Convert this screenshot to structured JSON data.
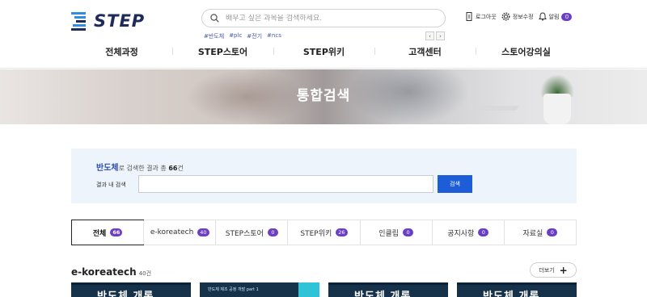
{
  "header": {
    "logo_text": "STEP",
    "search_placeholder": "배우고 싶은 과목을 검색하세요.",
    "tags": [
      "#반도체",
      "#plc",
      "#전기",
      "#ncs"
    ],
    "arrows": {
      "prev": "‹",
      "next": "›"
    },
    "util": {
      "logout": "로그아웃",
      "profile_edit": "정보수정",
      "alarm": "알림",
      "alarm_count": "0"
    }
  },
  "nav": [
    "전체과정",
    "STEP스토어",
    "STEP위키",
    "고객센터",
    "스토어강의실"
  ],
  "banner": {
    "title": "통합검색"
  },
  "result": {
    "keyword": "반도체",
    "summary_mid": "로 검색한 결과 총 ",
    "count": "66",
    "unit": "건",
    "inner_label": "결과 내 검색",
    "inner_value": "",
    "button": "검색"
  },
  "tabs": [
    {
      "label": "전체",
      "count": "66"
    },
    {
      "label": "e-koreatech",
      "count": "40"
    },
    {
      "label": "STEP스토어",
      "count": "0"
    },
    {
      "label": "STEP위키",
      "count": "26"
    },
    {
      "label": "인클립",
      "count": "0"
    },
    {
      "label": "공지사항",
      "count": "0"
    },
    {
      "label": "자료실",
      "count": "0"
    }
  ],
  "section": {
    "title": "e-koreatech",
    "count_text": "40건",
    "more_label": "더보기",
    "more_icon": "+"
  },
  "cards": [
    {
      "title": "반도체 개론",
      "sub": ""
    },
    {
      "title": "",
      "sub": "반도체 제조 공정 개발 part 1"
    },
    {
      "title": "반도체 개론",
      "sub": ""
    },
    {
      "title": "반도체 개론",
      "sub": ""
    }
  ],
  "colors": {
    "accent_purple": "#6b3fc5",
    "primary_blue": "#1d5ed8",
    "keyword_blue": "#2d4db0",
    "panel_bg": "#eef4fb",
    "logo_navy": "#1e2a5a"
  }
}
